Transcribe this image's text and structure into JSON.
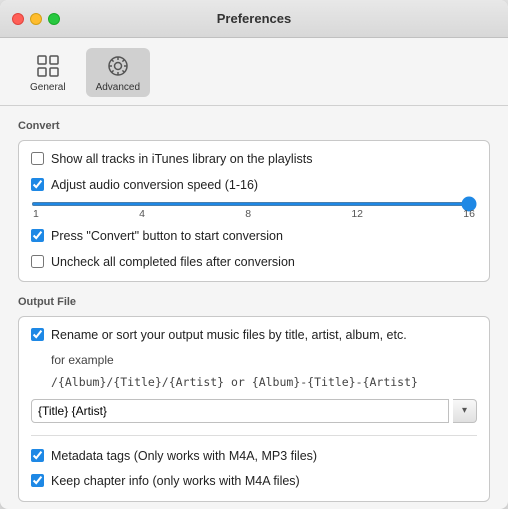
{
  "window": {
    "title": "Preferences"
  },
  "toolbar": {
    "general_label": "General",
    "advanced_label": "Advanced"
  },
  "convert_section": {
    "title": "Convert",
    "items": [
      {
        "id": "show-all-tracks",
        "label": "Show all tracks in iTunes library on the playlists",
        "checked": false
      },
      {
        "id": "adjust-audio",
        "label": "Adjust audio conversion speed (1-16)",
        "checked": true
      },
      {
        "id": "press-convert",
        "label": "Press \"Convert\" button to start conversion",
        "checked": true
      },
      {
        "id": "uncheck-completed",
        "label": "Uncheck all completed files after conversion",
        "checked": false
      }
    ],
    "slider": {
      "value": 16,
      "min": 1,
      "max": 16,
      "labels": [
        "1",
        "4",
        "8",
        "12",
        "16"
      ]
    }
  },
  "output_section": {
    "title": "Output File",
    "rename_label": "Rename or sort your output music files by title, artist, album, etc.",
    "rename_checked": true,
    "for_example": "for example",
    "example_path": "/{Album}/{Title}/{Artist} or {Album}-{Title}-{Artist}",
    "input_value": "{Title} {Artist}",
    "metadata_label": "Metadata tags (Only works with M4A, MP3 files)",
    "metadata_checked": true,
    "chapter_label": "Keep chapter info (only works with  M4A files)",
    "chapter_checked": true,
    "dropdown_arrow": "▾"
  },
  "icons": {
    "general": "⚙",
    "advanced": "⚙"
  }
}
